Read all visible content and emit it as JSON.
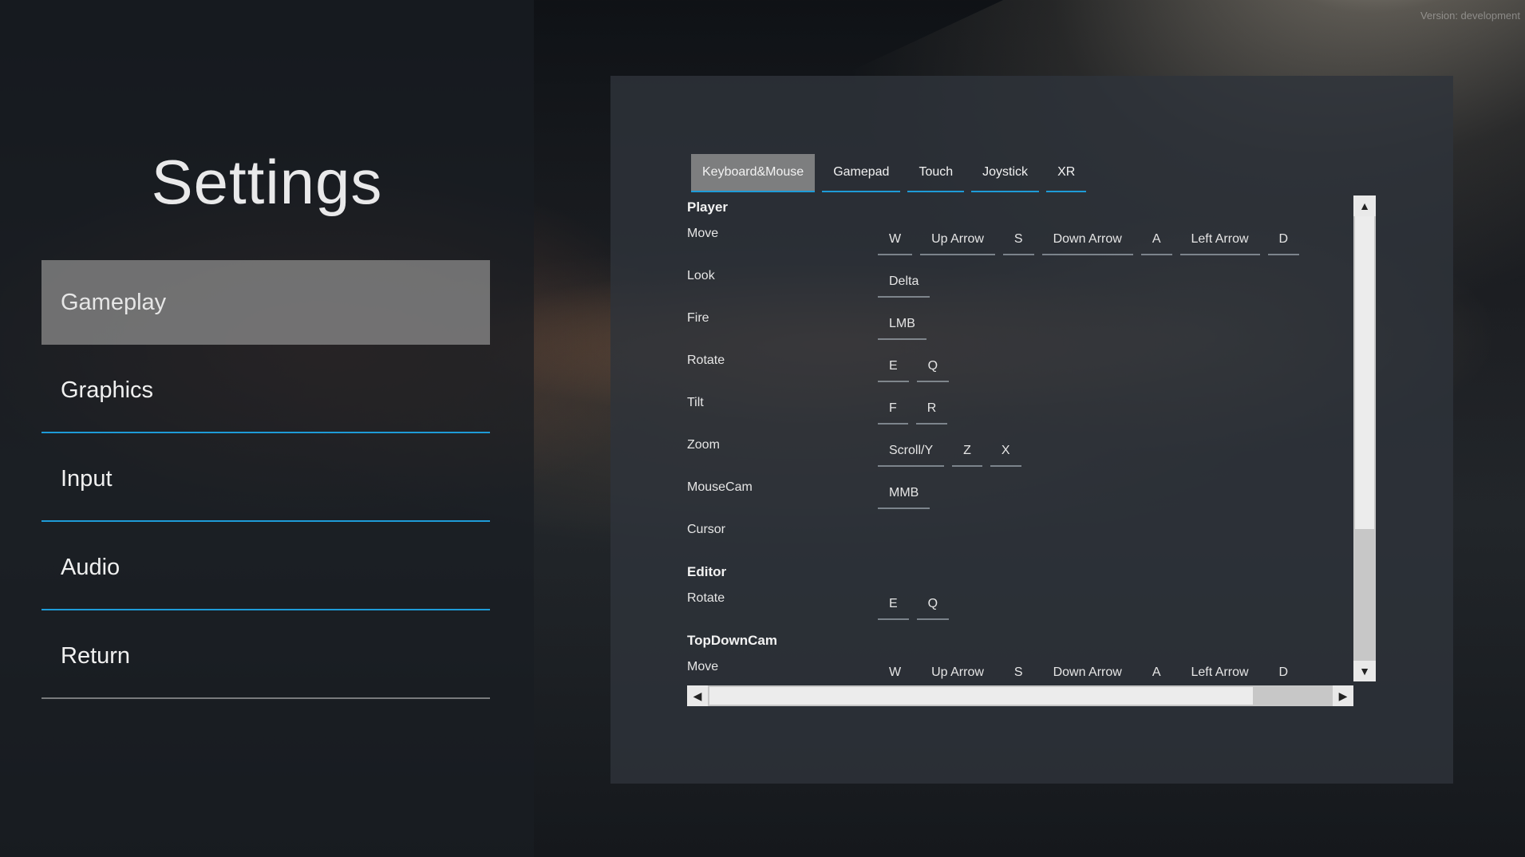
{
  "version_text": "Version: development",
  "sidebar": {
    "title": "Settings",
    "items": [
      {
        "label": "Gameplay",
        "selected": true
      },
      {
        "label": "Graphics"
      },
      {
        "label": "Input"
      },
      {
        "label": "Audio"
      },
      {
        "label": "Return"
      }
    ]
  },
  "input_panel": {
    "tabs": [
      {
        "label": "Keyboard&Mouse",
        "active": true
      },
      {
        "label": "Gamepad"
      },
      {
        "label": "Touch"
      },
      {
        "label": "Joystick"
      },
      {
        "label": "XR"
      }
    ],
    "sections": [
      {
        "title": "Player",
        "bindings": [
          {
            "action": "Move",
            "keys": [
              "W",
              "Up Arrow",
              "S",
              "Down Arrow",
              "A",
              "Left Arrow",
              "D"
            ]
          },
          {
            "action": "Look",
            "keys": [
              "Delta"
            ]
          },
          {
            "action": "Fire",
            "keys": [
              "LMB"
            ]
          },
          {
            "action": "Rotate",
            "keys": [
              "E",
              "Q"
            ]
          },
          {
            "action": "Tilt",
            "keys": [
              "F",
              "R"
            ]
          },
          {
            "action": "Zoom",
            "keys": [
              "Scroll/Y",
              "Z",
              "X"
            ]
          },
          {
            "action": "MouseCam",
            "keys": [
              "MMB"
            ]
          },
          {
            "action": "Cursor",
            "keys": []
          }
        ]
      },
      {
        "title": "Editor",
        "bindings": [
          {
            "action": "Rotate",
            "keys": [
              "E",
              "Q"
            ]
          }
        ]
      },
      {
        "title": "TopDownCam",
        "bindings": [
          {
            "action": "Move",
            "keys": [
              "W",
              "Up Arrow",
              "S",
              "Down Arrow",
              "A",
              "Left Arrow",
              "D"
            ]
          }
        ]
      }
    ]
  },
  "scrollbars": {
    "up_arrow": "▲",
    "down_arrow": "▼",
    "left_arrow": "◀",
    "right_arrow": "▶"
  },
  "colors": {
    "accent": "#1e9bd7",
    "selected_bg": "#8c8c8c",
    "panel_bg": "#2e333a"
  }
}
